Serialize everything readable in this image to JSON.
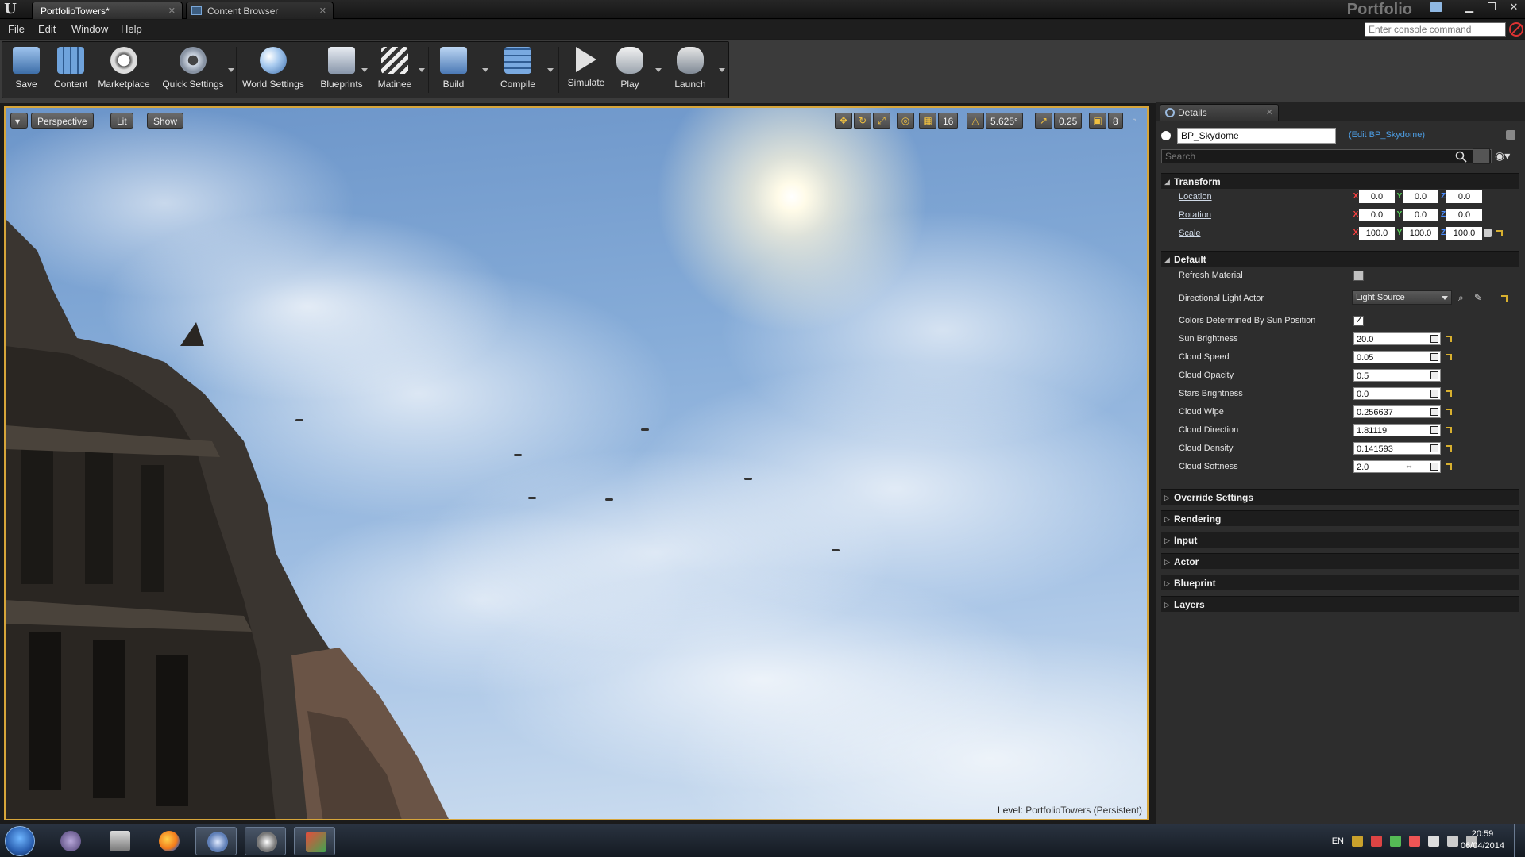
{
  "window": {
    "tabs": [
      {
        "label": "PortfolioTowers*"
      },
      {
        "label": "Content Browser"
      }
    ],
    "brand": "Portfolio"
  },
  "menu": [
    "File",
    "Edit",
    "Window",
    "Help"
  ],
  "console": {
    "placeholder": "Enter console command"
  },
  "toolbar": {
    "buttons": [
      {
        "label": "Save"
      },
      {
        "label": "Content"
      },
      {
        "label": "Marketplace"
      },
      {
        "label": "Quick Settings"
      },
      {
        "label": "World Settings"
      },
      {
        "label": "Blueprints"
      },
      {
        "label": "Matinee"
      },
      {
        "label": "Build"
      },
      {
        "label": "Compile"
      },
      {
        "label": "Simulate"
      },
      {
        "label": "Play"
      },
      {
        "label": "Launch"
      }
    ]
  },
  "viewport": {
    "perspective": "Perspective",
    "lit": "Lit",
    "show": "Show",
    "grid_snap": "16",
    "rotation_snap": "5.625°",
    "scale_snap": "0.25",
    "camera_speed": "8",
    "level_label": "Level:",
    "level_name": "PortfolioTowers (Persistent)"
  },
  "details": {
    "tab_label": "Details",
    "actor_name": "BP_Skydome",
    "edit_link": "(Edit BP_Skydome)",
    "search_placeholder": "Search",
    "sections": {
      "transform": "Transform",
      "default": "Default",
      "override": "Override Settings",
      "rendering": "Rendering",
      "input": "Input",
      "actor": "Actor",
      "blueprint": "Blueprint",
      "layers": "Layers"
    },
    "transform": {
      "location": {
        "label": "Location",
        "x": "0.0",
        "y": "0.0",
        "z": "0.0"
      },
      "rotation": {
        "label": "Rotation",
        "x": "0.0",
        "y": "0.0",
        "z": "0.0"
      },
      "scale": {
        "label": "Scale",
        "x": "100.0",
        "y": "100.0",
        "z": "100.0"
      }
    },
    "default": {
      "refresh_material": {
        "label": "Refresh Material",
        "checked": false
      },
      "directional_light": {
        "label": "Directional Light Actor",
        "value": "Light Source"
      },
      "colors_by_sun": {
        "label": "Colors Determined By Sun Position",
        "checked": true
      },
      "sun_brightness": {
        "label": "Sun Brightness",
        "value": "20.0"
      },
      "cloud_speed": {
        "label": "Cloud Speed",
        "value": "0.05"
      },
      "cloud_opacity": {
        "label": "Cloud Opacity",
        "value": "0.5"
      },
      "stars_brightness": {
        "label": "Stars Brightness",
        "value": "0.0"
      },
      "cloud_wipe": {
        "label": "Cloud Wipe",
        "value": "0.256637"
      },
      "cloud_direction": {
        "label": "Cloud Direction",
        "value": "1.81119"
      },
      "cloud_density": {
        "label": "Cloud Density",
        "value": "0.141593"
      },
      "cloud_softness": {
        "label": "Cloud Softness",
        "value": "2.0"
      }
    }
  },
  "taskbar": {
    "language": "EN",
    "time": "20:59",
    "date": "06/04/2014"
  },
  "colors": {
    "viewport_border": "#d6a53a",
    "link": "#4d9fe6",
    "axis_x": "#ff4040",
    "axis_y": "#59d659",
    "axis_z": "#4a8cff"
  }
}
